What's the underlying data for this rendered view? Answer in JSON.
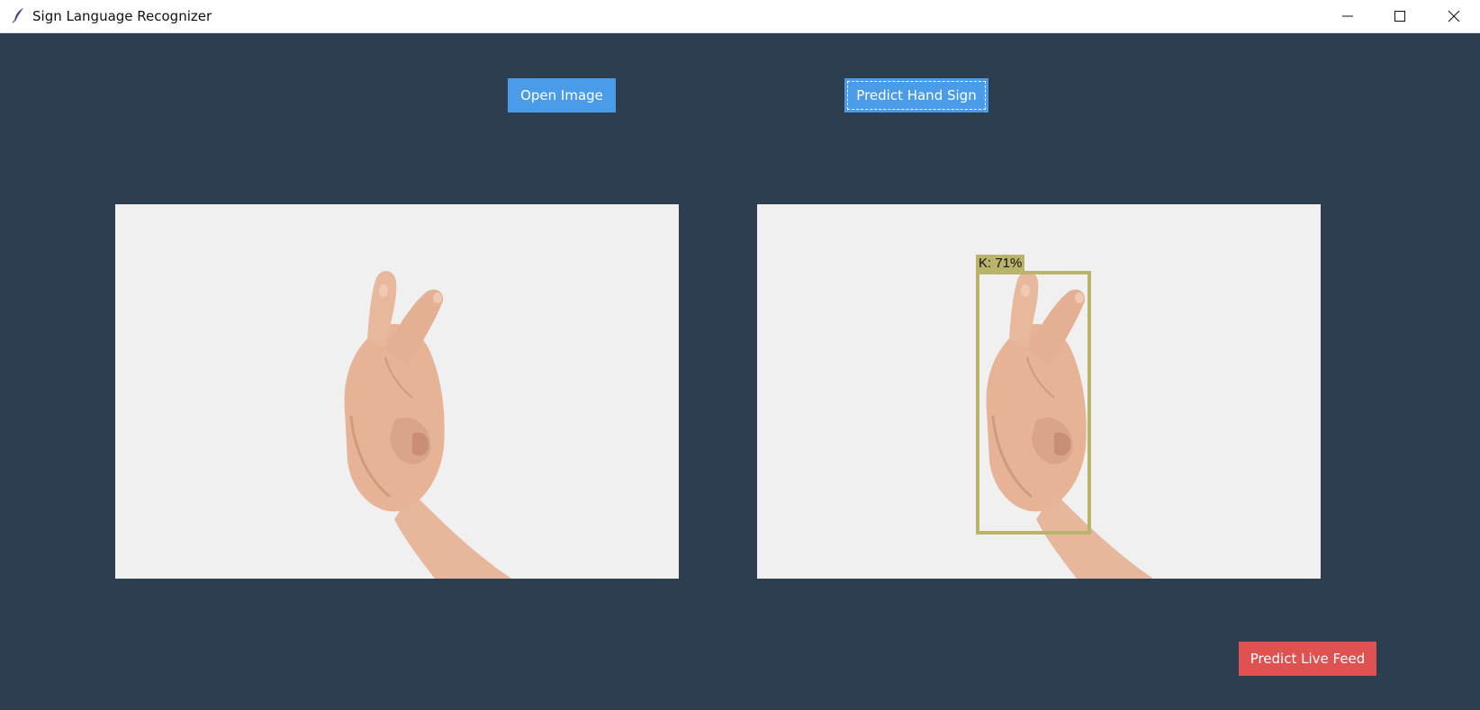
{
  "window": {
    "title": "Sign Language Recognizer",
    "background_color": "#2c3e50",
    "controls": [
      "minimize-icon",
      "maximize-icon",
      "close-icon"
    ]
  },
  "buttons": {
    "open_image": "Open Image",
    "predict_hand_sign": "Predict Hand Sign",
    "predict_live_feed": "Predict Live Feed"
  },
  "colors": {
    "primary_button": "#4a9be8",
    "danger_button": "#e05252",
    "bbox": "#b9b36b"
  },
  "prediction": {
    "label": "K: 71%",
    "letter": "K",
    "confidence_percent": 71
  }
}
